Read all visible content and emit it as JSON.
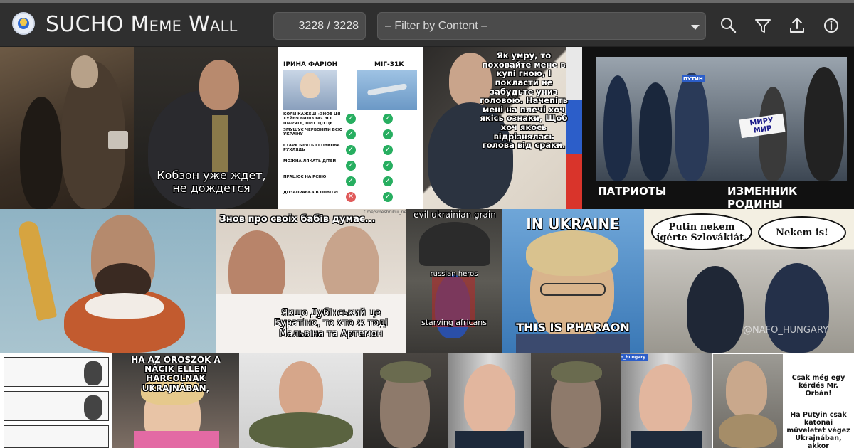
{
  "app": {
    "title": "SUCHO Meme Wall",
    "counter": "3228 / 3228",
    "filter_placeholder": "– Filter by Content –"
  },
  "header_buttons": [
    {
      "name": "search-icon"
    },
    {
      "name": "filter-icon"
    },
    {
      "name": "share-icon"
    },
    {
      "name": "info-icon"
    }
  ],
  "memes": {
    "kobzon": {
      "caption": "Кобзон уже ждет, не дождется"
    },
    "farion": {
      "col1": "ІРИНА ФАРІОН",
      "col2": "МІГ-31К",
      "rows": [
        "КОЛИ КАЖЕШ «ЗНОВ ЦЯ ХУЙНЯ ВИЛІЗЛА» ВСІ ШАРЯТЬ, ПРО ЩО ЦЕ",
        "ЗМУШУЄ ЧЕРВОНІТИ ВСЮ УКРАЇНУ",
        "СТАРА БЛЯТЬ І СОВКОВА РУХЛЯДЬ",
        "МОЖНА ЛЯКАТЬ ДІТЕЙ",
        "ПРАЦЮЄ НА РСНЮ",
        "ДОЗАПРАВКА В ПОВІТРІ"
      ]
    },
    "putin_writing": {
      "caption": "Як умру, то поховайте мене в купі гною, І покласти не забудьте униз головою. Начепіть мені на плечі хоч якісь ознаки, Щоб хоч якось відрізнялась голова від сраки."
    },
    "patriots": {
      "left": "ПАТРИОТЫ",
      "right": "ИЗМЕННИК РОДИНЫ",
      "sign": "МИРУ МИР",
      "cap": "ПУТИН"
    },
    "bed": {
      "top": "Знов про своїх бабів думає...",
      "bottom": "Якщо Дубінський це Буратіно, то хто ж тоді Мальвіна та Артемон",
      "watermark": "t.me/smeshnikui_net"
    },
    "superman": {
      "top": "evil ukrainian grain",
      "mid": "russian heros",
      "bottom": "starving africans"
    },
    "pharaon": {
      "top": "IN UKRAINE",
      "bottom": "THIS IS PHARAON"
    },
    "hungary": {
      "left": "Putin nekem ígérte Szlovákiát.",
      "right": "Nekem is!",
      "watermark": "@NAFO_HUNGARY"
    },
    "nacik": {
      "caption": "HA AZ OROSZOK A NÁCIK ELLEN HARCOLNAK UKRAJNÁBAN,"
    },
    "orban_q": {
      "top": "Csak még egy kérdés Mr. Orbán!",
      "bottom": "Ha Putyin csak katonai műveletet végez Ukrajnában, akkor"
    },
    "nafo_tag": "@nafo_hungary"
  },
  "colors": {
    "header_bg": "#2f2f2f",
    "control_bg": "#4b4b4b",
    "check_green": "#27ae60",
    "cross_red": "#e05a5a"
  }
}
